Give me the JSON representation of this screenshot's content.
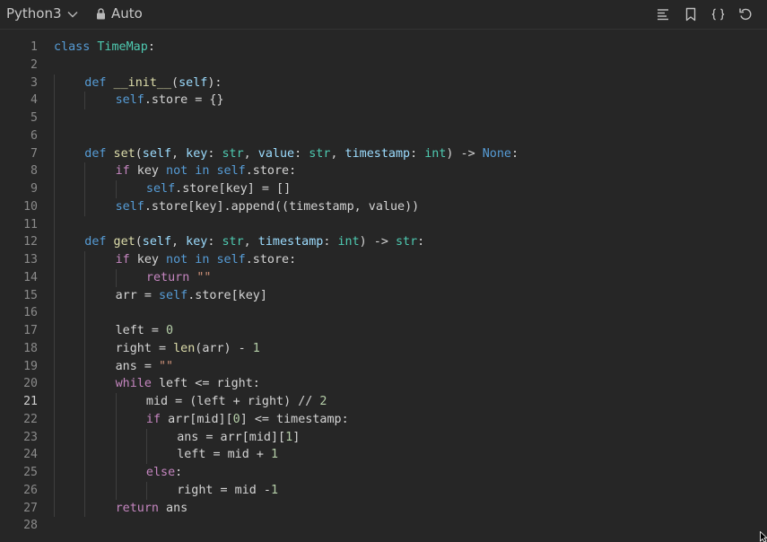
{
  "toolbar": {
    "language": "Python3",
    "mode": "Auto",
    "icons": [
      "format-icon",
      "bookmark-icon",
      "braces-icon",
      "reset-icon"
    ]
  },
  "editor": {
    "active_line": 21,
    "lines": [
      {
        "n": "1",
        "ind": 0,
        "tokens": [
          [
            "k",
            "class"
          ],
          [
            "t",
            " "
          ],
          [
            "c",
            "TimeMap"
          ],
          [
            "t",
            ":"
          ]
        ]
      },
      {
        "n": "2",
        "ind": 0,
        "tokens": []
      },
      {
        "n": "3",
        "ind": 1,
        "tokens": [
          [
            "k",
            "def"
          ],
          [
            "t",
            " "
          ],
          [
            "f",
            "__init__"
          ],
          [
            "t",
            "("
          ],
          [
            "p",
            "self"
          ],
          [
            "t",
            "):"
          ]
        ]
      },
      {
        "n": "4",
        "ind": 2,
        "tokens": [
          [
            "k",
            "self"
          ],
          [
            "t",
            ".store = {}"
          ]
        ]
      },
      {
        "n": "5",
        "ind": 0,
        "tokens": []
      },
      {
        "n": "6",
        "ind": 0,
        "tokens": []
      },
      {
        "n": "7",
        "ind": 1,
        "tokens": [
          [
            "k",
            "def"
          ],
          [
            "t",
            " "
          ],
          [
            "f",
            "set"
          ],
          [
            "t",
            "("
          ],
          [
            "p",
            "self"
          ],
          [
            "t",
            ", "
          ],
          [
            "p",
            "key"
          ],
          [
            "t",
            ": "
          ],
          [
            "c",
            "str"
          ],
          [
            "t",
            ", "
          ],
          [
            "p",
            "value"
          ],
          [
            "t",
            ": "
          ],
          [
            "c",
            "str"
          ],
          [
            "t",
            ", "
          ],
          [
            "p",
            "timestamp"
          ],
          [
            "t",
            ": "
          ],
          [
            "c",
            "int"
          ],
          [
            "t",
            ") -> "
          ],
          [
            "k",
            "None"
          ],
          [
            "t",
            ":"
          ]
        ]
      },
      {
        "n": "8",
        "ind": 2,
        "tokens": [
          [
            "kc",
            "if"
          ],
          [
            "t",
            " key "
          ],
          [
            "k",
            "not in"
          ],
          [
            "t",
            " "
          ],
          [
            "k",
            "self"
          ],
          [
            "t",
            ".store:"
          ]
        ]
      },
      {
        "n": "9",
        "ind": 3,
        "tokens": [
          [
            "k",
            "self"
          ],
          [
            "t",
            ".store[key] = []"
          ]
        ]
      },
      {
        "n": "10",
        "ind": 2,
        "tokens": [
          [
            "k",
            "self"
          ],
          [
            "t",
            ".store[key].append((timestamp, value))"
          ]
        ]
      },
      {
        "n": "11",
        "ind": 0,
        "tokens": []
      },
      {
        "n": "12",
        "ind": 1,
        "tokens": [
          [
            "k",
            "def"
          ],
          [
            "t",
            " "
          ],
          [
            "f",
            "get"
          ],
          [
            "t",
            "("
          ],
          [
            "p",
            "self"
          ],
          [
            "t",
            ", "
          ],
          [
            "p",
            "key"
          ],
          [
            "t",
            ": "
          ],
          [
            "c",
            "str"
          ],
          [
            "t",
            ", "
          ],
          [
            "p",
            "timestamp"
          ],
          [
            "t",
            ": "
          ],
          [
            "c",
            "int"
          ],
          [
            "t",
            ") -> "
          ],
          [
            "c",
            "str"
          ],
          [
            "t",
            ":"
          ]
        ]
      },
      {
        "n": "13",
        "ind": 2,
        "tokens": [
          [
            "kc",
            "if"
          ],
          [
            "t",
            " key "
          ],
          [
            "k",
            "not in"
          ],
          [
            "t",
            " "
          ],
          [
            "k",
            "self"
          ],
          [
            "t",
            ".store:"
          ]
        ]
      },
      {
        "n": "14",
        "ind": 3,
        "tokens": [
          [
            "kc",
            "return"
          ],
          [
            "t",
            " "
          ],
          [
            "s",
            "\"\""
          ]
        ]
      },
      {
        "n": "15",
        "ind": 2,
        "tokens": [
          [
            "t",
            "arr = "
          ],
          [
            "k",
            "self"
          ],
          [
            "t",
            ".store[key]"
          ]
        ]
      },
      {
        "n": "16",
        "ind": 0,
        "tokens": []
      },
      {
        "n": "17",
        "ind": 2,
        "tokens": [
          [
            "t",
            "left = "
          ],
          [
            "n",
            "0"
          ]
        ]
      },
      {
        "n": "18",
        "ind": 2,
        "tokens": [
          [
            "t",
            "right = "
          ],
          [
            "f",
            "len"
          ],
          [
            "t",
            "(arr) - "
          ],
          [
            "n",
            "1"
          ]
        ]
      },
      {
        "n": "19",
        "ind": 2,
        "tokens": [
          [
            "t",
            "ans = "
          ],
          [
            "s",
            "\"\""
          ]
        ]
      },
      {
        "n": "20",
        "ind": 2,
        "tokens": [
          [
            "kc",
            "while"
          ],
          [
            "t",
            " left <= right:"
          ]
        ]
      },
      {
        "n": "21",
        "ind": 3,
        "tokens": [
          [
            "t",
            "mid = (left + right) // "
          ],
          [
            "n",
            "2"
          ]
        ]
      },
      {
        "n": "22",
        "ind": 3,
        "tokens": [
          [
            "kc",
            "if"
          ],
          [
            "t",
            " arr[mid]["
          ],
          [
            "n",
            "0"
          ],
          [
            "t",
            "] <= timestamp:"
          ]
        ]
      },
      {
        "n": "23",
        "ind": 4,
        "tokens": [
          [
            "t",
            "ans = arr[mid]["
          ],
          [
            "n",
            "1"
          ],
          [
            "t",
            "]"
          ]
        ]
      },
      {
        "n": "24",
        "ind": 4,
        "tokens": [
          [
            "t",
            "left = mid + "
          ],
          [
            "n",
            "1"
          ]
        ]
      },
      {
        "n": "25",
        "ind": 3,
        "tokens": [
          [
            "kc",
            "else"
          ],
          [
            "t",
            ":"
          ]
        ]
      },
      {
        "n": "26",
        "ind": 4,
        "tokens": [
          [
            "t",
            "right = mid -"
          ],
          [
            "n",
            "1"
          ]
        ]
      },
      {
        "n": "27",
        "ind": 2,
        "tokens": [
          [
            "kc",
            "return"
          ],
          [
            "t",
            " ans"
          ]
        ]
      },
      {
        "n": "28",
        "ind": 0,
        "tokens": []
      }
    ]
  }
}
